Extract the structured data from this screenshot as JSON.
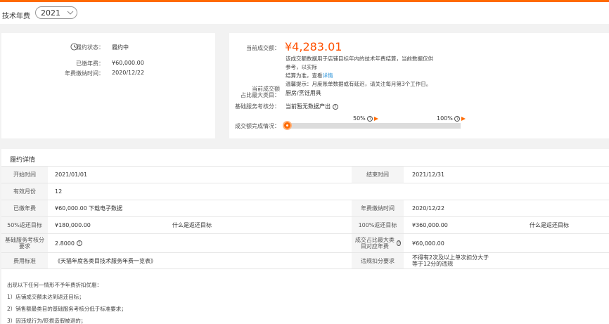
{
  "header": {
    "title": "技术年费",
    "year_value": "2021"
  },
  "summary_left": {
    "status_label": "履约状态：",
    "status_value": "履约中",
    "paid_label": "已缴年费：",
    "paid_value": "¥60,000.00",
    "pay_time_label": "年费缴纳时间：",
    "pay_time_value": "2020/12/22"
  },
  "summary_right": {
    "amount_label": "当前成交额：",
    "amount_value": "¥4,283.01",
    "note_line1": "该成交额数据用于店铺目标年内的技术年费结算，当前数据仅供参考，以实际",
    "note_line2_prefix": "结算为准，查看",
    "note_line2_link": "详情",
    "note_line3": "温馨提示：月度账单数据或有延迟，请关注每月第3个工作日。",
    "category_label_1": "当前成交额",
    "category_label_2": "占比最大类目：",
    "category_value": "厨房/烹饪用具",
    "basic_score_label": "基础服务考核分：",
    "basic_score_value": "当前暂无数据产出",
    "progress_label": "成交额完成情况：",
    "progress_fraction": 0.0,
    "marker_50": "50%",
    "marker_100": "100%"
  },
  "details": {
    "title": "履约详情",
    "rows": [
      {
        "l1": "开始时间",
        "v1": "2021/01/01",
        "l2": "结束时间",
        "v2": "2021/12/31"
      },
      {
        "l1": "有效月份",
        "v1": "12",
        "l2": "",
        "v2": ""
      },
      {
        "l1": "已缴年费",
        "v1": "¥60,000.00",
        "link1": "下载电子数据",
        "l2": "年费缴纳时间",
        "v2": "2020/12/22"
      },
      {
        "l1": "50%返还目标",
        "v1": "¥180,000.00",
        "link1": "什么是返还目标",
        "l2": "100%返还目标",
        "v2": "¥360,000.00",
        "link2": "什么是返还目标"
      },
      {
        "l1": "基础服务考核分要求",
        "v1": "2.8000",
        "l2": "成交占比最大类目对应年费",
        "v2": "¥60,000.00"
      },
      {
        "l1": "费用标准",
        "v1": "《天猫年度各类目技术服务年费一览表》",
        "l2": "违规扣分要求",
        "v2": "不得有2次及以上单次扣分大于等于12分的违规"
      }
    ],
    "notes": [
      "出现以下任何一情形不予年费折扣优惠：",
      "1）店铺成交额未达到返还目标；",
      "2）销售额最类目的基础服务考核分低于标准要求；",
      "3）因违规行为/贬损造假被退的；"
    ]
  },
  "colors": {
    "accent": "#ff6a00",
    "amount": "#ff5000",
    "link": "#1a8ad6"
  }
}
